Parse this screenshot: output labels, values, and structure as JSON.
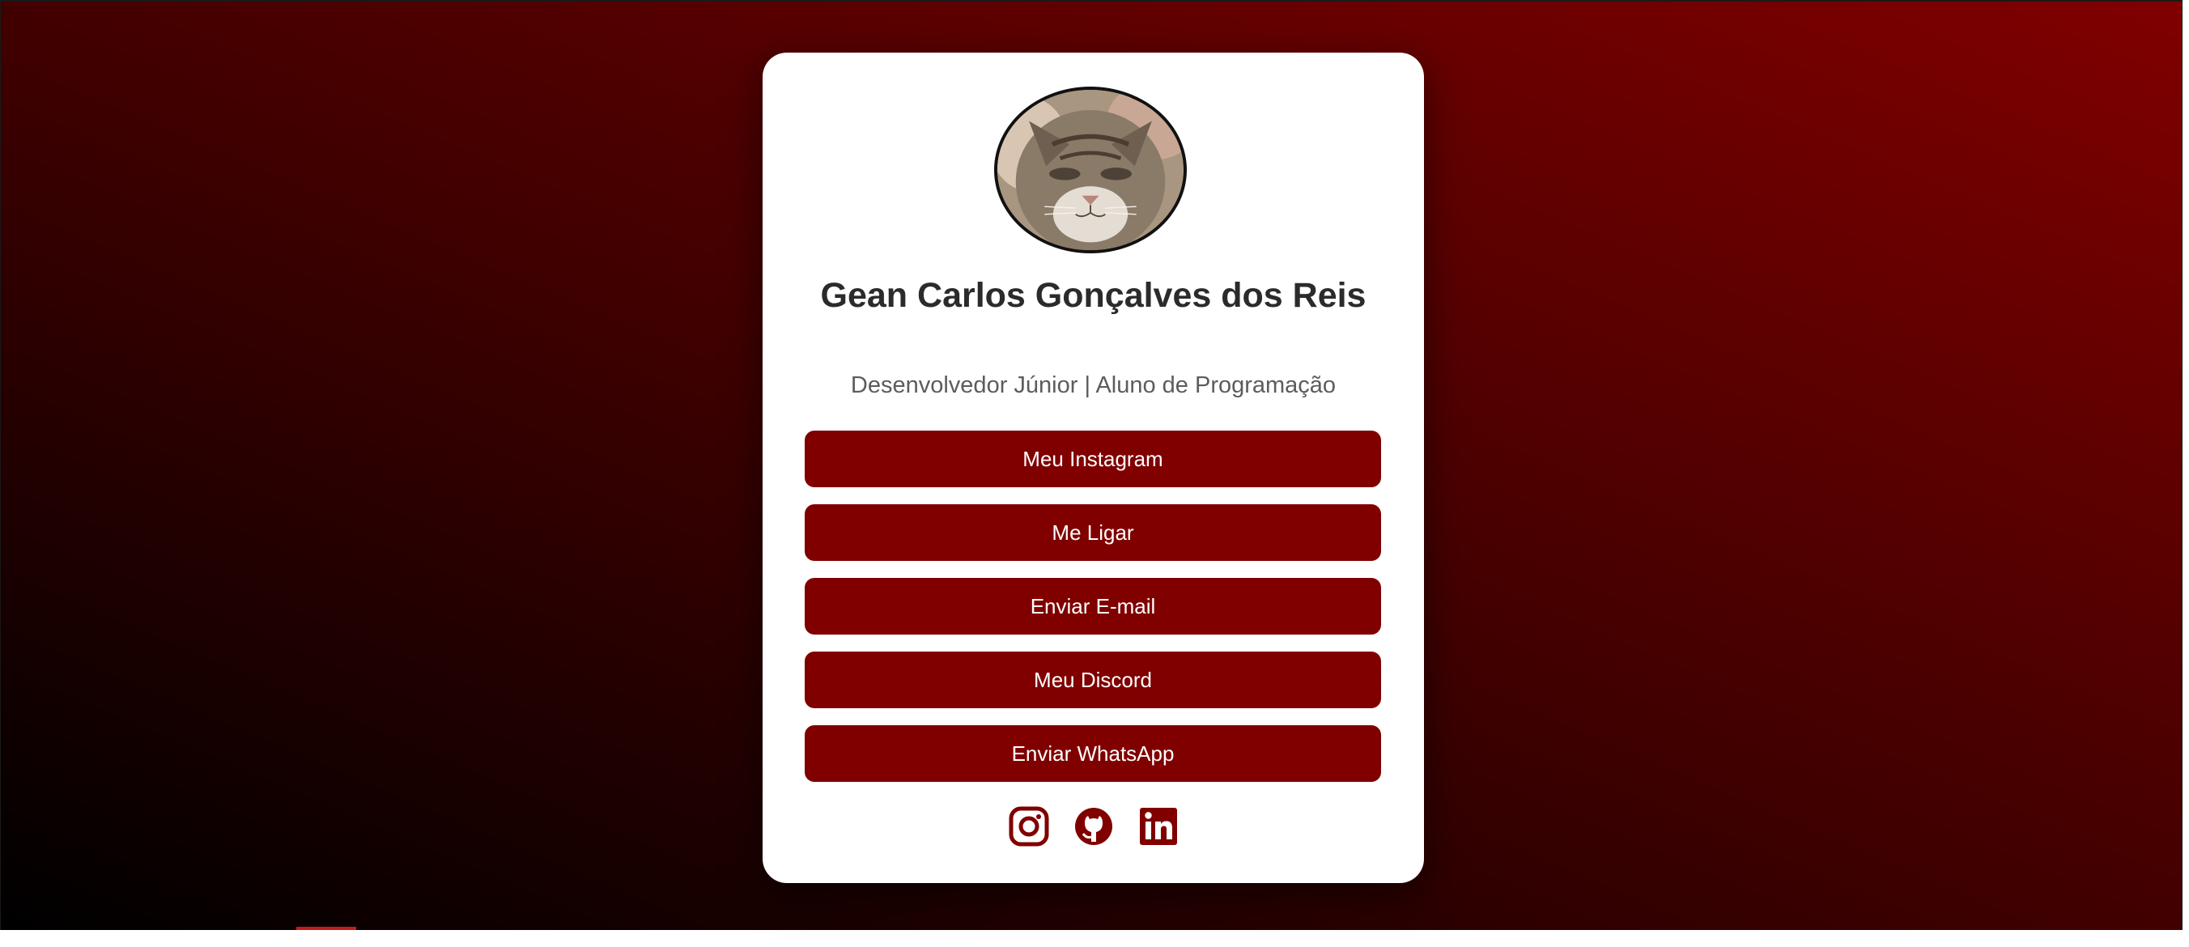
{
  "profile": {
    "avatar_icon": "cat-photo",
    "name": "Gean Carlos Gonçalves dos Reis",
    "subtitle": "Desenvolvedor Júnior | Aluno de Programação"
  },
  "links": [
    {
      "label": "Meu Instagram"
    },
    {
      "label": "Me Ligar"
    },
    {
      "label": "Enviar E-mail"
    },
    {
      "label": "Meu Discord"
    },
    {
      "label": "Enviar WhatsApp"
    }
  ],
  "socials": [
    {
      "icon": "instagram-icon"
    },
    {
      "icon": "github-icon"
    },
    {
      "icon": "linkedin-icon"
    }
  ],
  "colors": {
    "accent": "#800000",
    "background_start": "#000000",
    "background_end": "#800000",
    "card": "#ffffff",
    "name_text": "#2b2b2b",
    "subtitle_text": "#5c5c5c"
  }
}
